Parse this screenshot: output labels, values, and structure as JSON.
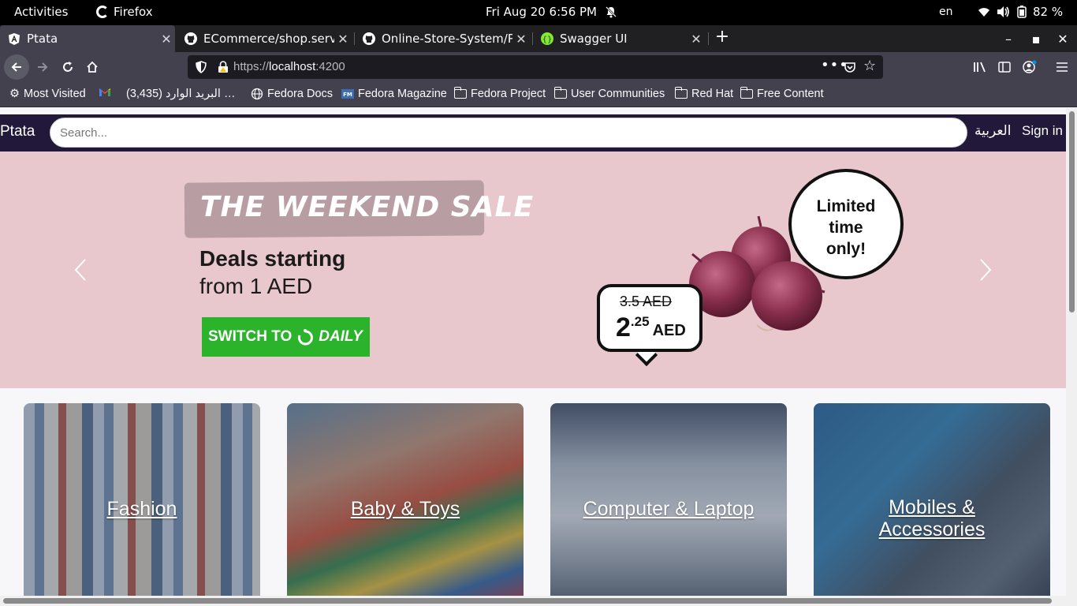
{
  "system_bar": {
    "activities": "Activities",
    "app_name": "Firefox",
    "clock": "Fri Aug 20  6:56 PM",
    "language": "en",
    "battery": "82 %"
  },
  "tabs": [
    {
      "title": "Ptata",
      "icon": "angular-icon",
      "active": true
    },
    {
      "title": "ECommerce/shop.service",
      "icon": "github-icon",
      "active": false
    },
    {
      "title": "Online-Store-System/Pro",
      "icon": "github-icon",
      "active": false
    },
    {
      "title": "Swagger UI",
      "icon": "swagger-icon",
      "active": false
    }
  ],
  "url": {
    "scheme": "https://",
    "host": "localhost",
    "port": ":4200"
  },
  "bookmarks": [
    {
      "label": "Most Visited",
      "icon": "gear-icon"
    },
    {
      "label": "",
      "icon": "gmail-icon"
    },
    {
      "label": "البريد الوارد (3,435) …",
      "icon": "none"
    },
    {
      "label": "Fedora Docs",
      "icon": "globe-icon"
    },
    {
      "label": "Fedora Magazine",
      "icon": "fm-icon"
    },
    {
      "label": "Fedora Project",
      "icon": "folder-icon"
    },
    {
      "label": "User Communities",
      "icon": "folder-icon"
    },
    {
      "label": "Red Hat",
      "icon": "folder-icon"
    },
    {
      "label": "Free Content",
      "icon": "folder-icon"
    }
  ],
  "site": {
    "brand": "Ptata",
    "search_placeholder": "Search...",
    "arabic_link": "العربية",
    "sign_in": "Sign in"
  },
  "hero": {
    "sale_title": "THE WEEKEND SALE",
    "deals_line1": "Deals starting",
    "deals_line2": "from 1 AED",
    "button_switch": "SWITCH TO",
    "button_brand": "DAILY",
    "bubble_line1": "Limited",
    "bubble_line2": "time",
    "bubble_line3": "only!",
    "old_price": "3.5 AED",
    "new_price_whole": "2",
    "new_price_decimal": ".25",
    "new_price_unit": "AED"
  },
  "categories": [
    {
      "label": "Fashion"
    },
    {
      "label": "Baby & Toys"
    },
    {
      "label": "Computer & Laptop"
    },
    {
      "label_line1": "Mobiles &",
      "label_line2": "Accessories"
    }
  ],
  "colors": {
    "header_bg": "#22183a",
    "hero_bg": "#e8c8cd",
    "switch_button": "#2bb32b"
  }
}
